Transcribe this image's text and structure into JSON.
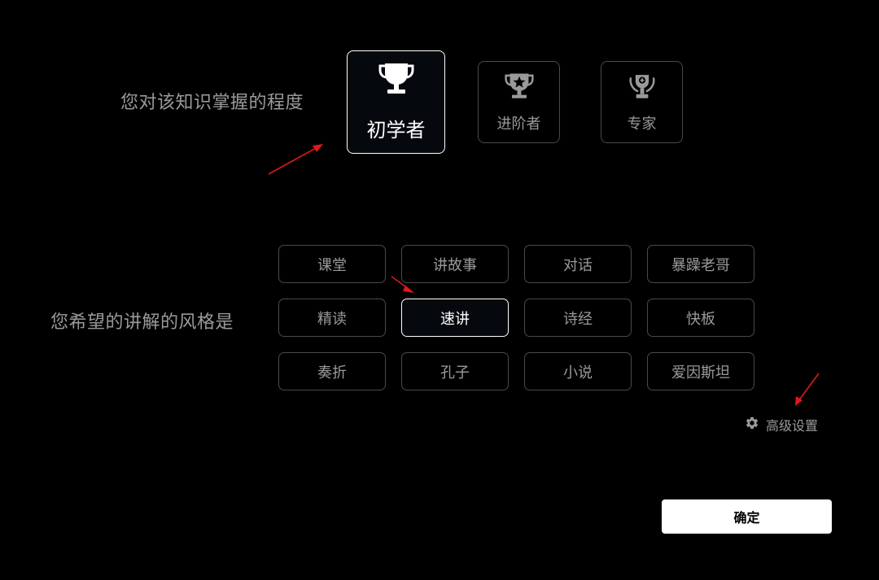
{
  "questions": {
    "level_prompt": "您对该知识掌握的程度",
    "style_prompt": "您希望的讲解的风格是"
  },
  "levels": [
    {
      "label": "初学者",
      "icon": "trophy-icon",
      "selected": true
    },
    {
      "label": "进阶者",
      "icon": "star-trophy-icon",
      "selected": false
    },
    {
      "label": "专家",
      "icon": "laurel-trophy-icon",
      "selected": false
    }
  ],
  "styles": [
    {
      "label": "课堂",
      "selected": false
    },
    {
      "label": "讲故事",
      "selected": false
    },
    {
      "label": "对话",
      "selected": false
    },
    {
      "label": "暴躁老哥",
      "selected": false
    },
    {
      "label": "精读",
      "selected": false
    },
    {
      "label": "速讲",
      "selected": true
    },
    {
      "label": "诗经",
      "selected": false
    },
    {
      "label": "快板",
      "selected": false
    },
    {
      "label": "奏折",
      "selected": false
    },
    {
      "label": "孔子",
      "selected": false
    },
    {
      "label": "小说",
      "selected": false
    },
    {
      "label": "爱因斯坦",
      "selected": false
    }
  ],
  "advanced": {
    "label": "高级设置",
    "icon": "gear-icon"
  },
  "confirm_label": "确定",
  "colors": {
    "background": "#000000",
    "selected_border": "#ffffff",
    "unselected_border": "#4a4a4a",
    "muted_text": "#9a9a9a",
    "annotation_arrow": "#e01818"
  }
}
